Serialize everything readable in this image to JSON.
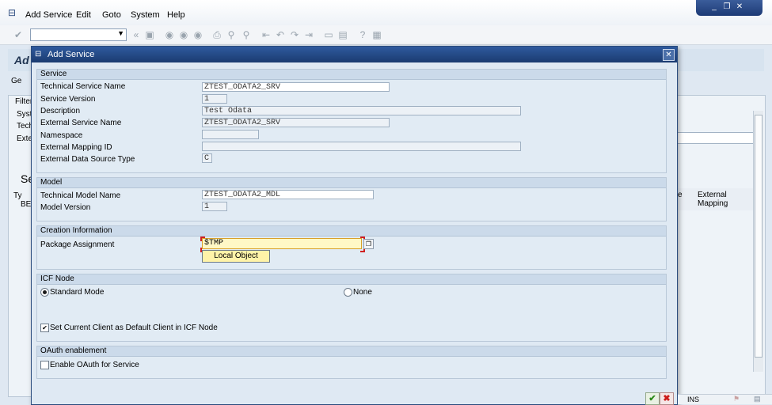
{
  "menu": {
    "items": [
      "Add Service",
      "Edit",
      "Goto",
      "System",
      "Help"
    ]
  },
  "background": {
    "title": "Ad",
    "goto_button": "Ge",
    "filter_label": "Filter",
    "sys_label": "Syst",
    "tech_label": "Tech",
    "ext_label": "Exte",
    "se_label": "Se",
    "ty_label": "Ty",
    "be_label": "BE",
    "col_e": "e",
    "col_external_mapping": "External Mapping"
  },
  "dialog": {
    "title": "Add Service",
    "groups": {
      "service": {
        "header": "Service",
        "technical_service_name_label": "Technical Service Name",
        "technical_service_name_value": "ZTEST_ODATA2_SRV",
        "service_version_label": "Service Version",
        "service_version_value": "1",
        "description_label": "Description",
        "description_value": "Test Odata",
        "external_service_name_label": "External Service Name",
        "external_service_name_value": "ZTEST_ODATA2_SRV",
        "namespace_label": "Namespace",
        "namespace_value": "",
        "external_mapping_id_label": "External Mapping ID",
        "external_mapping_id_value": "",
        "external_data_source_type_label": "External Data Source Type",
        "external_data_source_type_value": "C"
      },
      "model": {
        "header": "Model",
        "technical_model_name_label": "Technical Model Name",
        "technical_model_name_value": "ZTEST_ODATA2_MDL",
        "model_version_label": "Model Version",
        "model_version_value": "1"
      },
      "creation": {
        "header": "Creation Information",
        "package_assignment_label": "Package Assignment",
        "package_assignment_value": "$TMP",
        "suggestion": "Local Object"
      },
      "icf": {
        "header": "ICF Node",
        "standard_mode": "Standard Mode",
        "none": "None",
        "default_client": "Set Current Client as Default Client in ICF Node",
        "selected_mode": "Standard Mode",
        "default_client_checked": true
      },
      "oauth": {
        "header": "OAuth enablement",
        "enable_oauth": "Enable OAuth for Service",
        "enable_oauth_checked": false
      }
    }
  },
  "status": {
    "mode": "INS"
  },
  "colors": {
    "title_bar": "#1b3b70",
    "dialog_bg": "#dfe9f3",
    "required_field": "#fff8c6",
    "ok_green": "#2a8a1a",
    "cancel_red": "#cc1a1a"
  }
}
